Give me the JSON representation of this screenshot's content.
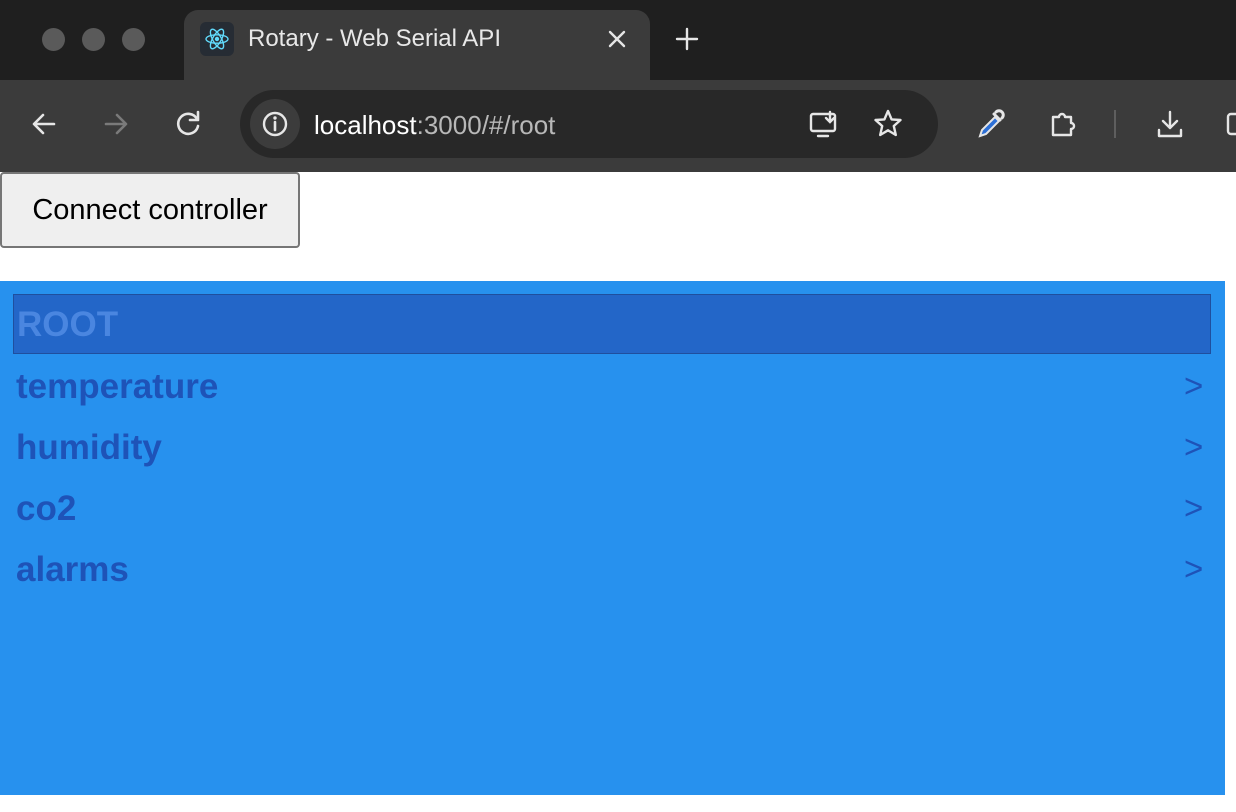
{
  "browser": {
    "tab": {
      "title": "Rotary - Web Serial API",
      "favicon": "react-icon"
    },
    "nav": {
      "back": "arrow-left-icon",
      "forward": "arrow-right-icon",
      "reload": "reload-icon"
    },
    "address": {
      "host": "localhost",
      "rest": ":3000/#/root"
    },
    "actions": [
      "install-app-icon",
      "star-icon",
      "eyedropper-icon",
      "extensions-icon",
      "download-icon",
      "side-panel-icon"
    ]
  },
  "page": {
    "connect_button": "Connect controller",
    "menu": {
      "title": "ROOT",
      "items": [
        {
          "label": "temperature",
          "arrow": ">"
        },
        {
          "label": "humidity",
          "arrow": ">"
        },
        {
          "label": "co2",
          "arrow": ">"
        },
        {
          "label": "alarms",
          "arrow": ">"
        }
      ]
    }
  },
  "colors": {
    "panel": "#2791ee",
    "selected_row": "#2366c8",
    "item_text": "#1e53b8",
    "chrome_dark": "#1f1f1f",
    "chrome_toolbar": "#3b3b3b"
  }
}
